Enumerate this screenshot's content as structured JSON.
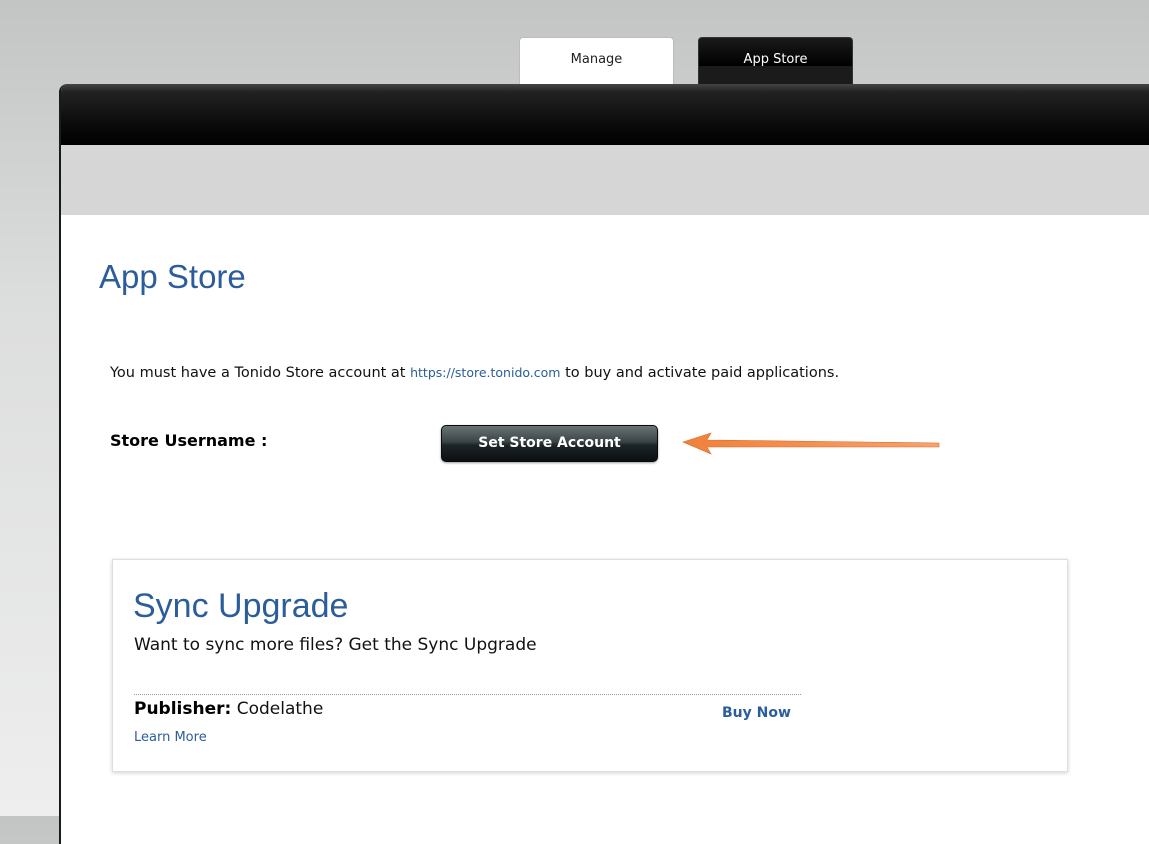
{
  "tabs": [
    {
      "label": "Manage",
      "active": false
    },
    {
      "label": "App Store",
      "active": true
    }
  ],
  "page": {
    "title": "App Store",
    "info_prefix": "You must have a Tonido Store account at ",
    "info_link": "https://store.tonido.com",
    "info_suffix": " to buy and activate paid applications.",
    "username_label": "Store Username :",
    "set_account_button": "Set Store Account"
  },
  "card": {
    "title": "Sync Upgrade",
    "description": "Want to sync more files? Get the Sync Upgrade",
    "publisher_label": "Publisher:",
    "publisher_value": " Codelathe",
    "buy_now": "Buy Now",
    "learn_more": "Learn More"
  },
  "colors": {
    "accent_blue": "#2b5d9a",
    "annotation_arrow": "#f0813a"
  },
  "icons": {
    "annotation": "orange-arrow-icon"
  }
}
